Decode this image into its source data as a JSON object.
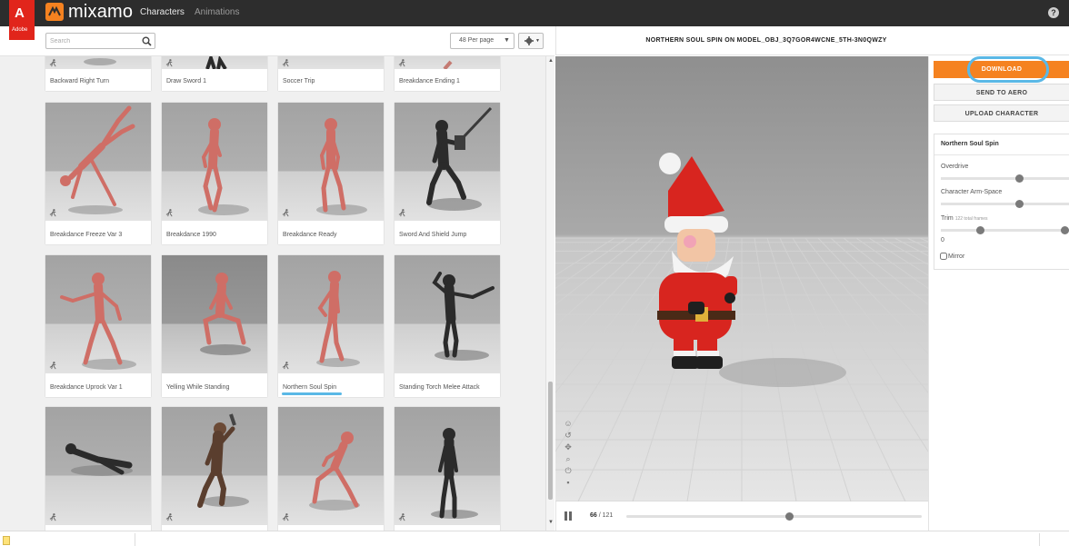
{
  "topbar": {
    "adobe_text": "Adobe",
    "brand": "mixamo",
    "nav": [
      "Characters",
      "Animations"
    ],
    "help": "?"
  },
  "toolbar": {
    "search_placeholder": "Search",
    "per_page": "48 Per page"
  },
  "grid": {
    "items": [
      "Backward Right Turn",
      "Draw Sword 1",
      "Soccer Trip",
      "Breakdance Ending 1",
      "Breakdance Freeze Var 3",
      "Breakdance 1990",
      "Breakdance Ready",
      "Sword And Shield Jump",
      "Breakdance Uprock Var 1",
      "Yelling While Standing",
      "Northern Soul Spin",
      "Standing Torch Melee Attack"
    ]
  },
  "viewer": {
    "title": "NORTHERN SOUL SPIN ON MODEL_OBJ_3Q7GOR4WCNE_5TH-3N0QWZY",
    "frame_current": "66",
    "frame_total": "/ 121",
    "progress": 0.55
  },
  "panel": {
    "download": "DOWNLOAD",
    "send_to_aero": "SEND TO AERO",
    "upload_character": "UPLOAD CHARACTER",
    "animation_name": "Northern Soul Spin",
    "overdrive_label": "Overdrive",
    "overdrive_value": 0.6,
    "arm_space_label": "Character Arm-Space",
    "arm_space_value": 0.6,
    "trim_label": "Trim",
    "trim_frames": "122 total frames",
    "trim_start": 0.3,
    "trim_end": 0.95,
    "trim_value": "0",
    "mirror_label": "Mirror"
  },
  "colors": {
    "accent": "#f58220",
    "highlight": "#5ab8e6",
    "topbar": "#2d2d2d",
    "adobe_red": "#e1251b"
  }
}
